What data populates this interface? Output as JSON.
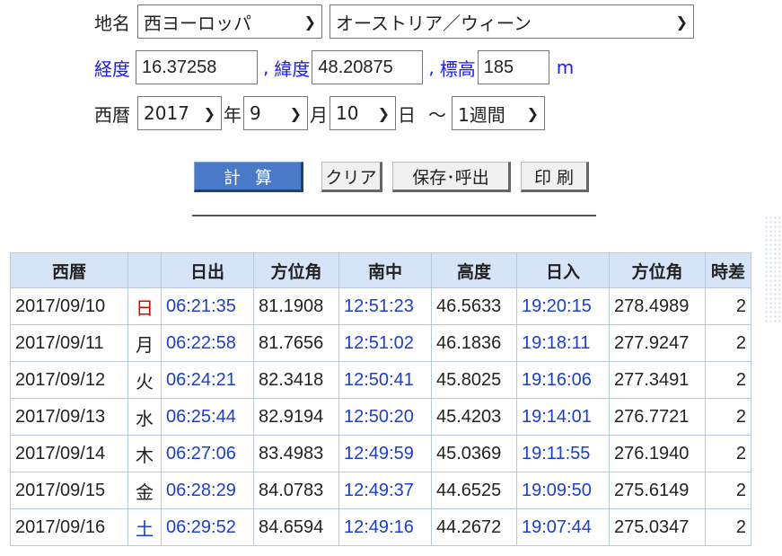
{
  "location": {
    "label": "地名",
    "region": "西ヨーロッパ",
    "city": "オーストリア／ウィーン"
  },
  "coords": {
    "lon_label": "経度",
    "lon": "16.37258",
    "sep1": ",",
    "lat_label": "緯度",
    "lat": "48.20875",
    "sep2": ",",
    "alt_label": "標高",
    "alt": "185",
    "alt_unit": "m"
  },
  "date": {
    "label": "西暦",
    "year": "2017",
    "year_unit": "年",
    "month": "9",
    "month_unit": "月",
    "day": "10",
    "day_unit": "日",
    "tilde": "～",
    "period": "1週間"
  },
  "buttons": {
    "calc": "計算",
    "clear": "クリア",
    "save": "保存･呼出",
    "print": "印 刷"
  },
  "table": {
    "headers": [
      "西暦",
      "",
      "日出",
      "方位角",
      "南中",
      "高度",
      "日入",
      "方位角",
      "時差"
    ],
    "rows": [
      {
        "date": "2017/09/10",
        "wd": "日",
        "wd_color": "#e00000",
        "rise": "06:21:35",
        "az1": "81.1908",
        "transit": "12:51:23",
        "alt": "46.5633",
        "set": "19:20:15",
        "az2": "278.4989",
        "diff": "2"
      },
      {
        "date": "2017/09/11",
        "wd": "月",
        "wd_color": "#222222",
        "rise": "06:22:58",
        "az1": "81.7656",
        "transit": "12:51:02",
        "alt": "46.1836",
        "set": "19:18:11",
        "az2": "277.9247",
        "diff": "2"
      },
      {
        "date": "2017/09/12",
        "wd": "火",
        "wd_color": "#222222",
        "rise": "06:24:21",
        "az1": "82.3418",
        "transit": "12:50:41",
        "alt": "45.8025",
        "set": "19:16:06",
        "az2": "277.3491",
        "diff": "2"
      },
      {
        "date": "2017/09/13",
        "wd": "水",
        "wd_color": "#222222",
        "rise": "06:25:44",
        "az1": "82.9194",
        "transit": "12:50:20",
        "alt": "45.4203",
        "set": "19:14:01",
        "az2": "276.7721",
        "diff": "2"
      },
      {
        "date": "2017/09/14",
        "wd": "木",
        "wd_color": "#222222",
        "rise": "06:27:06",
        "az1": "83.4983",
        "transit": "12:49:59",
        "alt": "45.0369",
        "set": "19:11:55",
        "az2": "276.1940",
        "diff": "2"
      },
      {
        "date": "2017/09/15",
        "wd": "金",
        "wd_color": "#222222",
        "rise": "06:28:29",
        "az1": "84.0783",
        "transit": "12:49:37",
        "alt": "44.6525",
        "set": "19:09:50",
        "az2": "275.6149",
        "diff": "2"
      },
      {
        "date": "2017/09/16",
        "wd": "土",
        "wd_color": "#1a3fd0",
        "rise": "06:29:52",
        "az1": "84.6594",
        "transit": "12:49:16",
        "alt": "44.2672",
        "set": "19:07:44",
        "az2": "275.0347",
        "diff": "2"
      }
    ]
  }
}
